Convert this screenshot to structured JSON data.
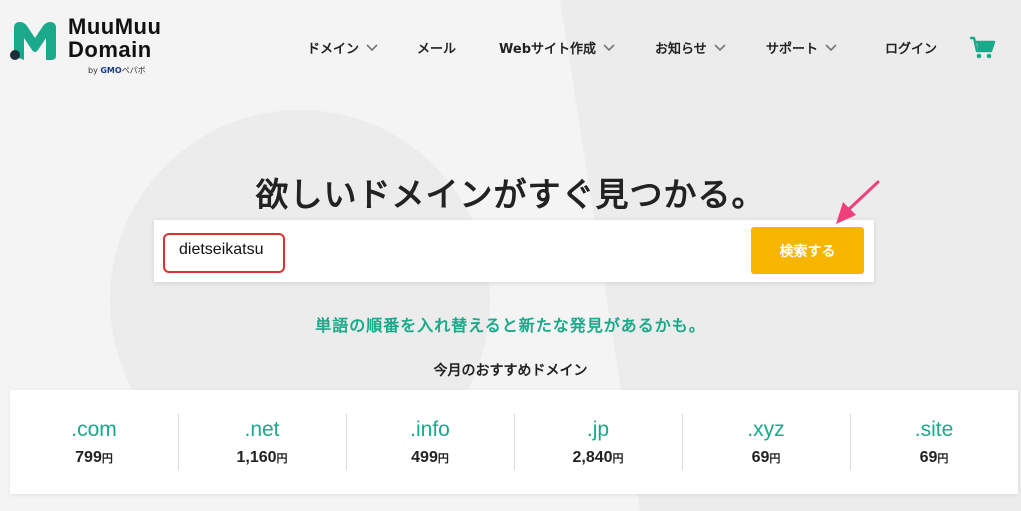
{
  "brand": {
    "line1": "MuuMuu",
    "line2": "Domain",
    "by": "by",
    "gmo": "GMO",
    "pepabo": "ペパボ",
    "colors": {
      "teal": "#1aa98a",
      "dark": "#1e2d3b"
    }
  },
  "nav": {
    "items": [
      {
        "label": "ドメイン",
        "has_dropdown": true
      },
      {
        "label": "メール",
        "has_dropdown": false
      },
      {
        "label": "Webサイト作成",
        "has_dropdown": true
      },
      {
        "label": "お知らせ",
        "has_dropdown": true
      },
      {
        "label": "サポート",
        "has_dropdown": true
      },
      {
        "label": "ログイン",
        "has_dropdown": false
      }
    ],
    "cart_icon": "cart-icon"
  },
  "hero": {
    "headline": "欲しいドメインがすぐ見つかる。",
    "search_value": "dietseikatsu",
    "search_button": "検索する",
    "tagline": "単語の順番を入れ替えると新たな発見があるかも。"
  },
  "recommend": {
    "title": "今月のおすすめドメイン",
    "yen": "円",
    "domains": [
      {
        "tld": ".com",
        "price": "799"
      },
      {
        "tld": ".net",
        "price": "1,160"
      },
      {
        "tld": ".info",
        "price": "499"
      },
      {
        "tld": ".jp",
        "price": "2,840"
      },
      {
        "tld": ".xyz",
        "price": "69"
      },
      {
        "tld": ".site",
        "price": "69"
      }
    ]
  },
  "colors": {
    "accent": "#1aa98a",
    "button": "#f7b500",
    "annotation_red": "#e03030",
    "arrow_pink": "#f0407a"
  }
}
